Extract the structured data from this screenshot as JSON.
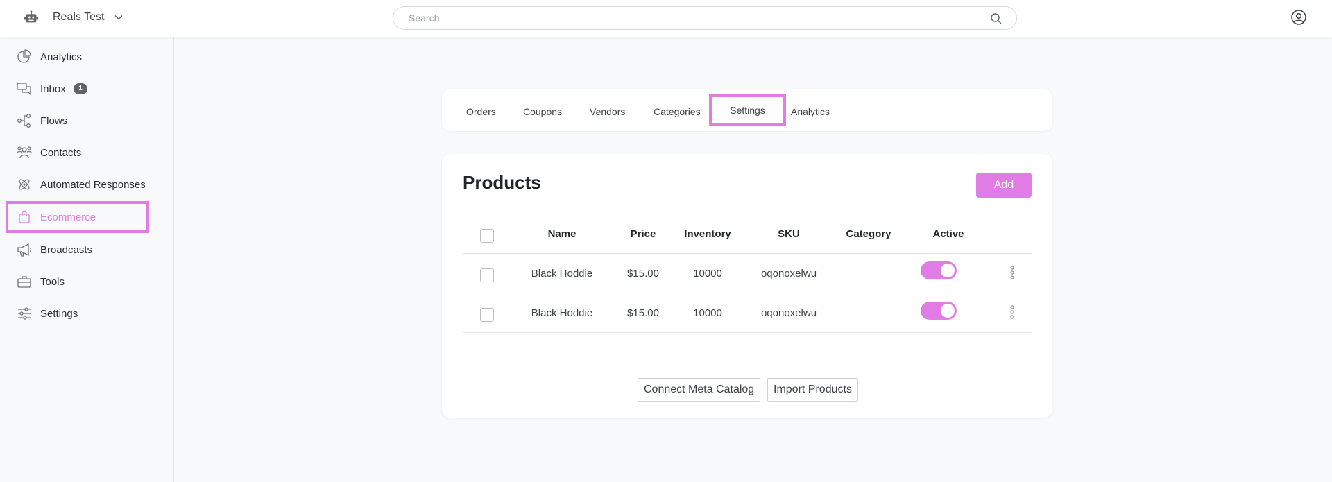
{
  "workspace": {
    "name": "Reals Test"
  },
  "search": {
    "placeholder": "Search",
    "value": ""
  },
  "sidebar": {
    "items": [
      {
        "label": "Analytics",
        "icon": "pie-chart-icon"
      },
      {
        "label": "Inbox",
        "icon": "chat-bubbles-icon",
        "badge": "1"
      },
      {
        "label": "Flows",
        "icon": "flow-nodes-icon"
      },
      {
        "label": "Contacts",
        "icon": "people-icon"
      },
      {
        "label": "Automated Responses",
        "icon": "atom-icon"
      },
      {
        "label": "Ecommerce",
        "icon": "shopping-bag-icon",
        "active": true
      },
      {
        "label": "Broadcasts",
        "icon": "megaphone-icon"
      },
      {
        "label": "Tools",
        "icon": "toolbox-icon"
      },
      {
        "label": "Settings",
        "icon": "sliders-icon"
      }
    ]
  },
  "tabs": [
    {
      "label": "Orders"
    },
    {
      "label": "Coupons"
    },
    {
      "label": "Vendors"
    },
    {
      "label": "Categories"
    },
    {
      "label": "Settings",
      "highlighted": true
    },
    {
      "label": "Analytics"
    }
  ],
  "products": {
    "title": "Products",
    "add_label": "Add",
    "columns": [
      "Name",
      "Price",
      "Inventory",
      "SKU",
      "Category",
      "Active"
    ],
    "rows": [
      {
        "name": "Black Hoddie",
        "price": "$15.00",
        "inventory": "10000",
        "sku": "oqonoxelwu",
        "category": "",
        "active": true
      },
      {
        "name": "Black Hoddie",
        "price": "$15.00",
        "inventory": "10000",
        "sku": "oqonoxelwu",
        "category": "",
        "active": true
      }
    ],
    "connect_label": "Connect Meta Catalog",
    "import_label": "Import Products"
  },
  "colors": {
    "accent": "#e07ce3",
    "badge": "#5f6368"
  }
}
